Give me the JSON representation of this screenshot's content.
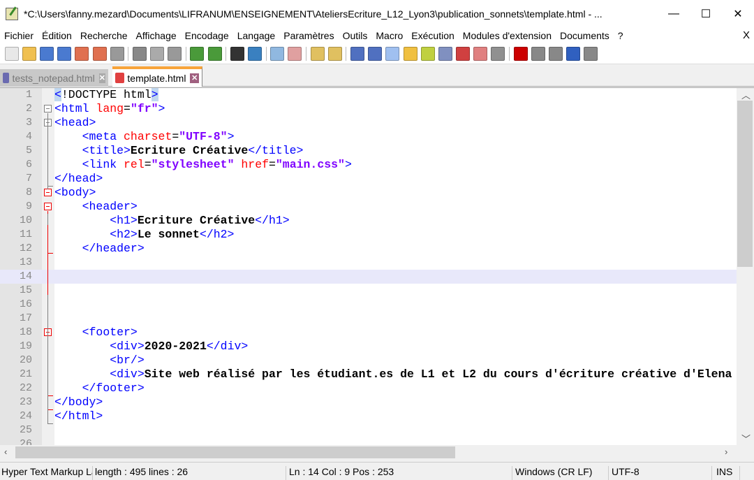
{
  "window": {
    "title": "*C:\\Users\\fanny.mezard\\Documents\\LIFRANUM\\ENSEIGNEMENT\\AteliersEcriture_L12_Lyon3\\publication_sonnets\\template.html - ...",
    "minimize": "—",
    "maximize": "☐",
    "close": "✕"
  },
  "menu": [
    "Fichier",
    "Édition",
    "Recherche",
    "Affichage",
    "Encodage",
    "Langage",
    "Paramètres",
    "Outils",
    "Macro",
    "Exécution",
    "Modules d'extension",
    "Documents",
    "?"
  ],
  "menu_close": "X",
  "toolbar": [
    {
      "name": "new-file",
      "color": "#e8e8e8"
    },
    {
      "name": "open-file",
      "color": "#f0c050"
    },
    {
      "name": "save",
      "color": "#4a7ad0"
    },
    {
      "name": "save-all",
      "color": "#4a7ad0"
    },
    {
      "name": "close",
      "color": "#e07050"
    },
    {
      "name": "close-all",
      "color": "#e07050"
    },
    {
      "name": "print",
      "color": "#999"
    },
    "sep",
    {
      "name": "cut",
      "color": "#888"
    },
    {
      "name": "copy",
      "color": "#aaa"
    },
    {
      "name": "paste",
      "color": "#999"
    },
    "sep",
    {
      "name": "undo",
      "color": "#4a9a3a"
    },
    {
      "name": "redo",
      "color": "#4a9a3a"
    },
    "sep",
    {
      "name": "find",
      "color": "#333"
    },
    {
      "name": "replace",
      "color": "#3a80c0"
    },
    "sep",
    {
      "name": "zoom-in",
      "color": "#90b8e0"
    },
    {
      "name": "zoom-out",
      "color": "#e0a0a0"
    },
    "sep",
    {
      "name": "sync-vertical",
      "color": "#e0c060"
    },
    {
      "name": "sync-horizontal",
      "color": "#e0c060"
    },
    "sep",
    {
      "name": "word-wrap",
      "color": "#5070c0"
    },
    {
      "name": "show-all-chars",
      "color": "#5070c0"
    },
    {
      "name": "indent-guide",
      "color": "#a0c0f0"
    },
    {
      "name": "udl",
      "color": "#f0c040"
    },
    {
      "name": "doc-map",
      "color": "#c0d040"
    },
    {
      "name": "function-list",
      "color": "#8090c0"
    },
    {
      "name": "folder-workspace",
      "color": "#d04040"
    },
    {
      "name": "folder",
      "color": "#e08080"
    },
    {
      "name": "monitor",
      "color": "#909090"
    },
    "sep",
    {
      "name": "record-macro",
      "color": "#c00"
    },
    {
      "name": "stop-record",
      "color": "#888"
    },
    {
      "name": "play-macro",
      "color": "#888"
    },
    {
      "name": "run-macro-multiple",
      "color": "#3060c0"
    },
    {
      "name": "save-macro",
      "color": "#888"
    }
  ],
  "tabs": [
    {
      "label": "tests_notepad.html",
      "active": false,
      "close": "✕"
    },
    {
      "label": "template.html",
      "active": true,
      "close": "✕"
    }
  ],
  "editor": {
    "current_line": 14,
    "lines": [
      [
        [
          "hl",
          "<"
        ],
        [
          "plain",
          "!DOCTYPE html"
        ],
        [
          "hl",
          ">"
        ]
      ],
      [
        [
          "tag",
          "<html "
        ],
        [
          "attr",
          "lang"
        ],
        [
          "plain",
          "="
        ],
        [
          "val",
          "\"fr\""
        ],
        [
          "tag",
          ">"
        ]
      ],
      [
        [
          "tag",
          "<head>"
        ]
      ],
      [
        [
          "plain",
          "    "
        ],
        [
          "tag",
          "<meta "
        ],
        [
          "attr",
          "charset"
        ],
        [
          "plain",
          "="
        ],
        [
          "val",
          "\"UTF-8\""
        ],
        [
          "tag",
          ">"
        ]
      ],
      [
        [
          "plain",
          "    "
        ],
        [
          "tag",
          "<title>"
        ],
        [
          "text",
          "Ecriture Créative"
        ],
        [
          "tag",
          "</title>"
        ]
      ],
      [
        [
          "plain",
          "    "
        ],
        [
          "tag",
          "<link "
        ],
        [
          "attr",
          "rel"
        ],
        [
          "plain",
          "="
        ],
        [
          "val",
          "\"stylesheet\""
        ],
        [
          "plain",
          " "
        ],
        [
          "attr",
          "href"
        ],
        [
          "plain",
          "="
        ],
        [
          "val",
          "\"main.css\""
        ],
        [
          "tag",
          ">"
        ]
      ],
      [
        [
          "tag",
          "</head>"
        ]
      ],
      [
        [
          "tag",
          "<body>"
        ]
      ],
      [
        [
          "plain",
          "    "
        ],
        [
          "tag",
          "<header>"
        ]
      ],
      [
        [
          "plain",
          "        "
        ],
        [
          "tag",
          "<h1>"
        ],
        [
          "text",
          "Ecriture Créative"
        ],
        [
          "tag",
          "</h1>"
        ]
      ],
      [
        [
          "plain",
          "        "
        ],
        [
          "tag",
          "<h2>"
        ],
        [
          "text",
          "Le sonnet"
        ],
        [
          "tag",
          "</h2>"
        ]
      ],
      [
        [
          "plain",
          "    "
        ],
        [
          "tag",
          "</header>"
        ]
      ],
      [],
      [],
      [],
      [],
      [],
      [
        [
          "plain",
          "    "
        ],
        [
          "tag",
          "<footer>"
        ]
      ],
      [
        [
          "plain",
          "        "
        ],
        [
          "tag",
          "<div>"
        ],
        [
          "text",
          "2020-2021"
        ],
        [
          "tag",
          "</div>"
        ]
      ],
      [
        [
          "plain",
          "        "
        ],
        [
          "tag",
          "<br/>"
        ]
      ],
      [
        [
          "plain",
          "        "
        ],
        [
          "tag",
          "<div>"
        ],
        [
          "text",
          "Site web réalisé par les étudiant.es de L1 et L2 du cours d'écriture créative d'Elena"
        ]
      ],
      [
        [
          "plain",
          "    "
        ],
        [
          "tag",
          "</footer>"
        ]
      ],
      [
        [
          "tag",
          "</body>"
        ]
      ],
      [
        [
          "tag",
          "</html>"
        ]
      ],
      [],
      []
    ]
  },
  "status": {
    "language": "Hyper Text Markup Language file",
    "length": "length : 495    lines : 26",
    "position": "Ln : 14    Col : 9    Pos : 253",
    "eol": "Windows (CR LF)",
    "encoding": "UTF-8",
    "mode": "INS"
  }
}
